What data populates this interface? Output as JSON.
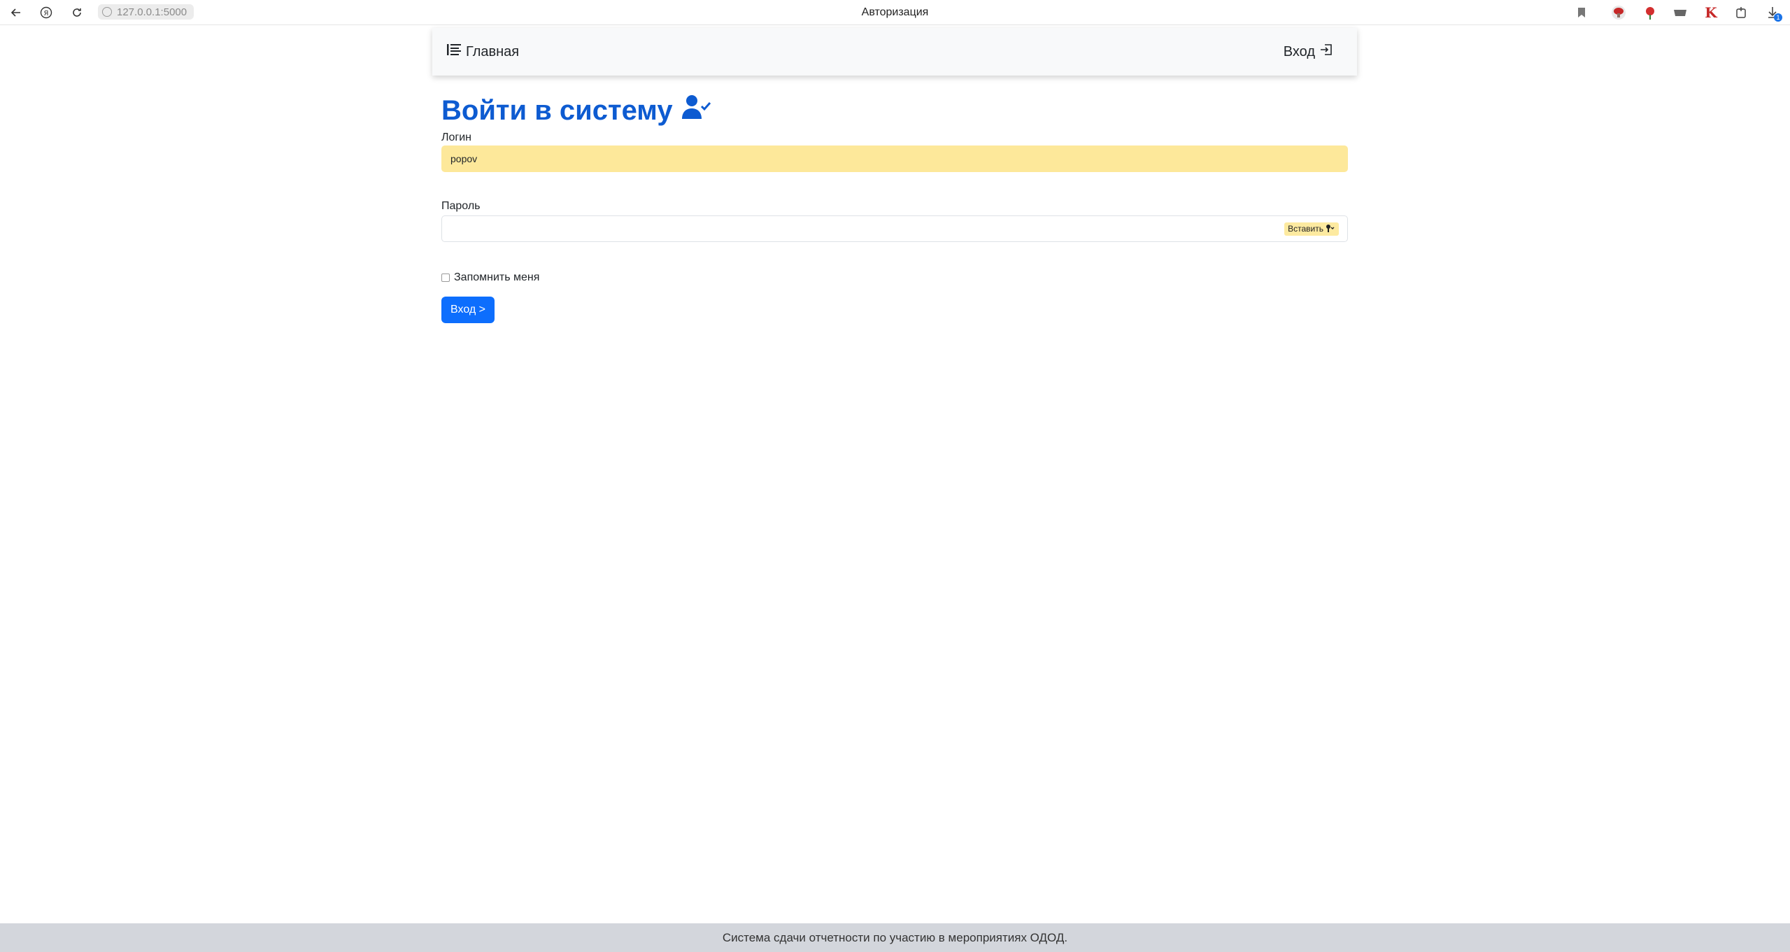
{
  "browser": {
    "url": "127.0.0.1:5000",
    "tab_title": "Авторизация",
    "download_badge": "1"
  },
  "navbar": {
    "home_label": "Главная",
    "home_icon": "list-icon",
    "login_label": "Вход",
    "login_icon": "sign-in-icon"
  },
  "page": {
    "title": "Войти в систему",
    "title_icon": "user-check-icon"
  },
  "form": {
    "login_label": "Логин",
    "login_value": "popov",
    "password_label": "Пароль",
    "password_value": "",
    "paste_label": "Вставить",
    "remember_label": "Запомнить меня",
    "remember_checked": false,
    "submit_label": "Вход >"
  },
  "footer": {
    "text": "Система сдачи отчетности по участию в мероприятиях ОДОД."
  },
  "colors": {
    "title": "#0d5bd1",
    "primary": "#0d6efd",
    "autofill": "#fde89a",
    "footer_bg": "#d3d6dc"
  }
}
